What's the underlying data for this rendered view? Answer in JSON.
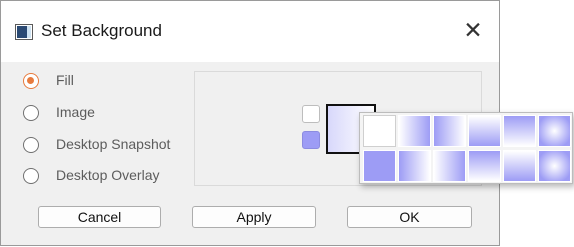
{
  "window": {
    "title": "Set Background"
  },
  "options": [
    {
      "label": "Fill",
      "selected": true
    },
    {
      "label": "Image",
      "selected": false
    },
    {
      "label": "Desktop Snapshot",
      "selected": false
    },
    {
      "label": "Desktop Overlay",
      "selected": false
    }
  ],
  "colors": {
    "accent": "#e77b3e",
    "fill_primary": "#ffffff",
    "fill_secondary": "#9d9cf5"
  },
  "gradient_palette": {
    "row1": [
      "solid-white",
      "gradient-left-right",
      "gradient-right-left",
      "gradient-top-bottom",
      "gradient-bottom-top",
      "radial-center"
    ],
    "row2": [
      "solid-blue",
      "gradient-left-right",
      "gradient-right-left",
      "gradient-top-bottom",
      "gradient-bottom-top",
      "radial-center"
    ]
  },
  "buttons": {
    "cancel": "Cancel",
    "apply": "Apply",
    "ok": "OK"
  }
}
